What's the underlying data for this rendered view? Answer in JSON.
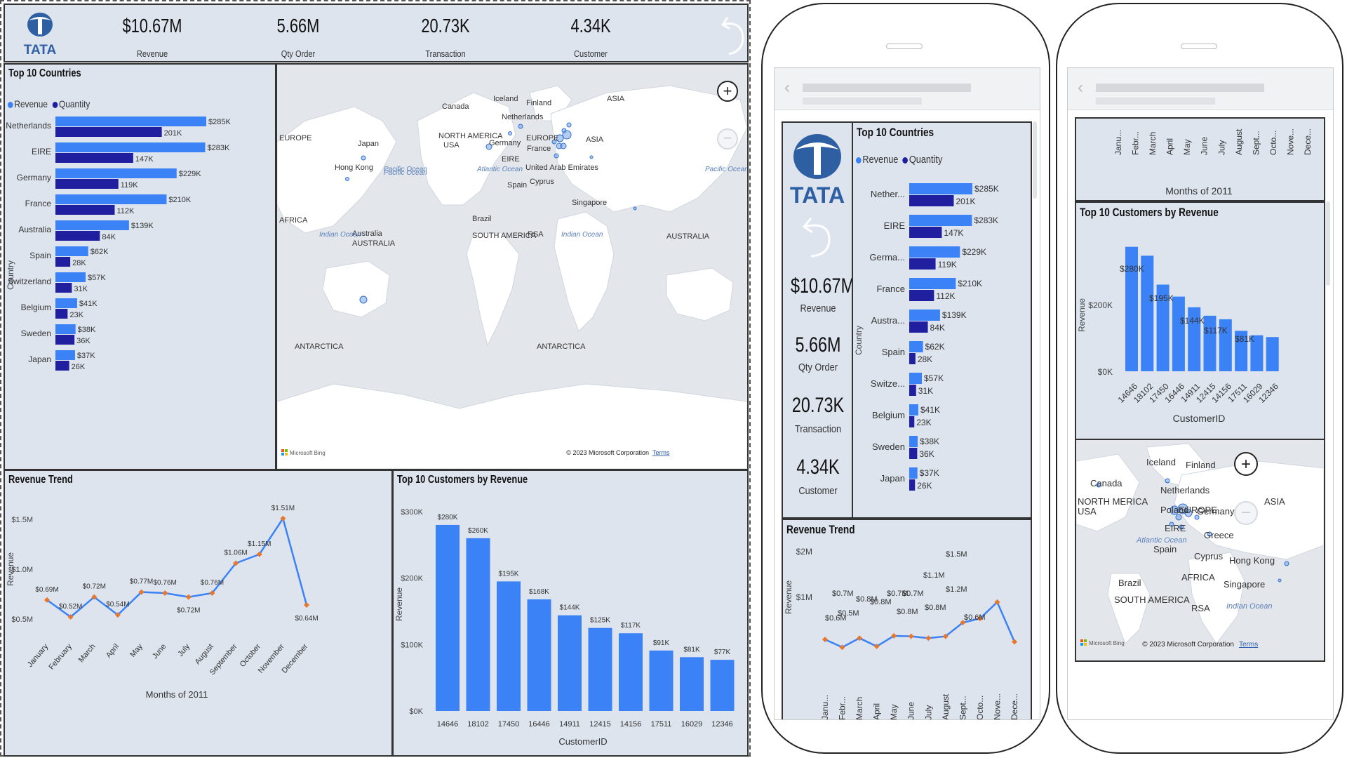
{
  "brand": {
    "name": "TATA"
  },
  "colors": {
    "revenue": "#3b82f6",
    "quantity": "#1f1fa0",
    "panel": "#dde4ee",
    "marker": "#e8772e"
  },
  "kpis": [
    {
      "value": "$10.67M",
      "label": "Revenue"
    },
    {
      "value": "5.66M",
      "label": "Qty Order"
    },
    {
      "value": "20.73K",
      "label": "Transaction"
    },
    {
      "value": "4.34K",
      "label": "Customer"
    }
  ],
  "countries": {
    "title": "Top 10 Countries",
    "legend": [
      "Revenue",
      "Quantity"
    ],
    "axis_label": "Country",
    "labels_mobile": [
      "Nether...",
      "EIRE",
      "Germa...",
      "France",
      "Austra...",
      "Spain",
      "Switze...",
      "Belgium",
      "Sweden",
      "Japan"
    ]
  },
  "map": {
    "labels": [
      "Canada",
      "Iceland",
      "Finland",
      "Netherlands",
      "NORTH AMERICA",
      "USA",
      "Germany",
      "EUROPE",
      "France",
      "EIRE",
      "Atlantic Ocean",
      "Spain",
      "United Arab Emirates",
      "Cyprus",
      "ASIA",
      "Japan",
      "Hong Kong",
      "Pacific Ocean",
      "AFRICA",
      "Brazil",
      "SOUTH AMERICA",
      "RSA",
      "Indian Ocean",
      "Australia",
      "AUSTRALIA",
      "Singapore",
      "ANTARCTICA"
    ],
    "attribution": "© 2023 Microsoft Corporation",
    "terms": "Terms",
    "bing": "Microsoft Bing",
    "zoom_in": "+",
    "zoom_out": "−",
    "mobile_labels": [
      "Iceland",
      "Finland",
      "Canada",
      "Netherlands",
      "NORTH MERICA",
      "USA",
      "Poland",
      "EUROPE",
      "Germany",
      "EIRE",
      "Atlantic Ocean",
      "Greece",
      "Spain",
      "Cyprus",
      "Hong Kong",
      "ASIA",
      "Brazil",
      "AFRICA",
      "Singapore",
      "SOUTH AMERICA",
      "RSA",
      "Indian Ocean"
    ]
  },
  "trend": {
    "title": "Revenue Trend",
    "xlabel": "Months of 2011",
    "ylabel": "Revenue",
    "mobile_month_labels": [
      "Janu...",
      "Febr...",
      "March",
      "April",
      "May",
      "June",
      "July",
      "August",
      "Sept...",
      "Octo...",
      "Nove...",
      "Dece..."
    ],
    "mobile_value_labels": [
      "$0.7M",
      "$0.6M",
      "$0.5M",
      "$0.8M",
      "$0.8M",
      "$0.7M",
      "$0.8M",
      "$0.8M",
      "$0.7M",
      "$1.1M",
      "$1.2M",
      "$1.5M",
      "$0.6M"
    ],
    "mobile_yticks": [
      "$2M",
      "$1M"
    ]
  },
  "customers": {
    "title": "Top 10 Customers by Revenue",
    "xlabel": "CustomerID",
    "ylabel": "Revenue",
    "mobile_labels": [
      "$280K",
      "$195K",
      "$144K",
      "$117K",
      "$81K"
    ],
    "mobile_yticks": [
      "$200K",
      "$0K"
    ]
  },
  "chart_data": [
    {
      "type": "bar",
      "title": "Top 10 Countries",
      "ylabel": "Country",
      "categories": [
        "Netherlands",
        "EIRE",
        "Germany",
        "France",
        "Australia",
        "Spain",
        "Switzerland",
        "Belgium",
        "Sweden",
        "Japan"
      ],
      "series": [
        {
          "name": "Revenue",
          "values": [
            285,
            283,
            229,
            210,
            139,
            62,
            57,
            41,
            38,
            37
          ],
          "labels": [
            "$285K",
            "$283K",
            "$229K",
            "$210K",
            "$139K",
            "$62K",
            "$57K",
            "$41K",
            "$38K",
            "$37K"
          ]
        },
        {
          "name": "Quantity",
          "values": [
            201,
            147,
            119,
            112,
            84,
            28,
            31,
            23,
            36,
            26
          ],
          "labels": [
            "201K",
            "147K",
            "119K",
            "112K",
            "84K",
            "28K",
            "31K",
            "23K",
            "36K",
            "26K"
          ]
        }
      ]
    },
    {
      "type": "line",
      "title": "Revenue Trend",
      "xlabel": "Months of 2011",
      "ylabel": "Revenue",
      "x": [
        "January",
        "February",
        "March",
        "April",
        "May",
        "June",
        "July",
        "August",
        "September",
        "October",
        "November",
        "December"
      ],
      "values": [
        0.69,
        0.52,
        0.72,
        0.54,
        0.77,
        0.76,
        0.72,
        0.76,
        1.06,
        1.15,
        1.51,
        0.64
      ],
      "labels": [
        "$0.69M",
        "$0.52M",
        "$0.72M",
        "$0.54M",
        "$0.77M",
        "$0.76M",
        "$0.72M",
        "$0.76M",
        "$1.06M",
        "$1.15M",
        "$1.51M",
        "$0.64M"
      ],
      "yticks": [
        "$0.5M",
        "$1.0M",
        "$1.5M"
      ],
      "ylim": [
        0.4,
        1.6
      ]
    },
    {
      "type": "bar",
      "title": "Top 10 Customers by Revenue",
      "xlabel": "CustomerID",
      "ylabel": "Revenue",
      "categories": [
        "14646",
        "18102",
        "17450",
        "16446",
        "14911",
        "12415",
        "14156",
        "17511",
        "16029",
        "12346"
      ],
      "values": [
        280,
        260,
        195,
        168,
        144,
        125,
        117,
        91,
        81,
        77
      ],
      "labels": [
        "$280K",
        "$260K",
        "$195K",
        "$168K",
        "$144K",
        "$125K",
        "$117K",
        "$91K",
        "$81K",
        "$77K"
      ],
      "yticks": [
        "$0K",
        "$100K",
        "$200K",
        "$300K"
      ],
      "ylim": [
        0,
        300
      ]
    }
  ]
}
